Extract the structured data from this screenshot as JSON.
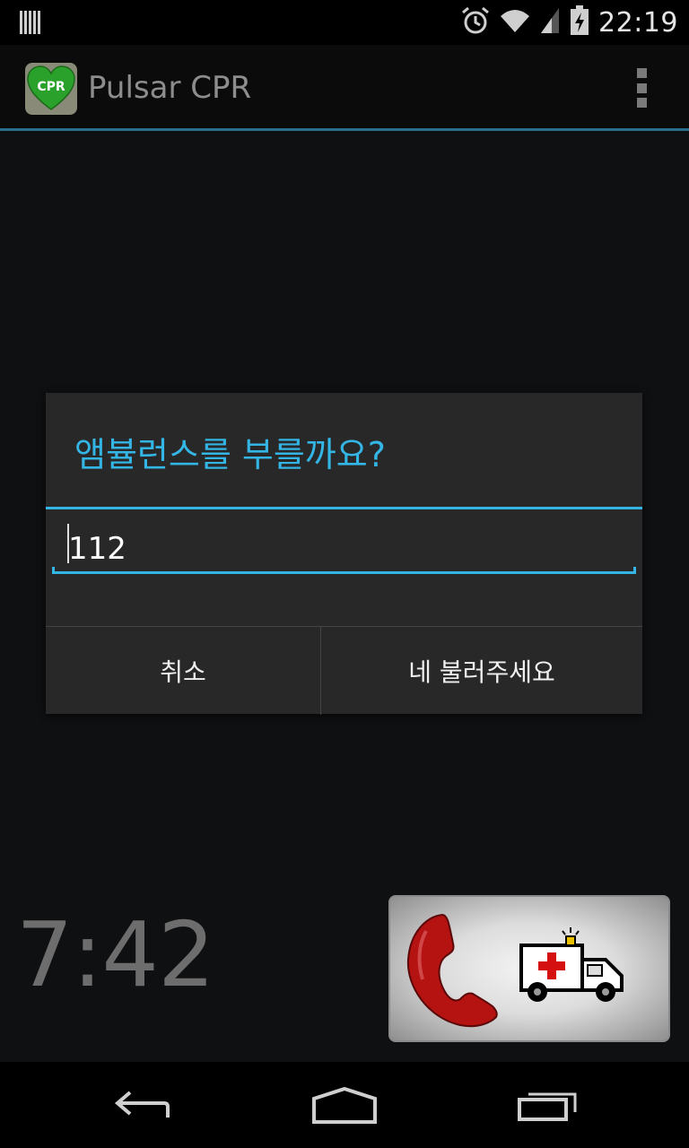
{
  "status_bar": {
    "time": "22:19",
    "icons": [
      "notification-bars-icon",
      "alarm-icon",
      "wifi-icon",
      "signal-icon",
      "battery-charging-icon"
    ]
  },
  "action_bar": {
    "app_icon_label": "CPR",
    "title": "Pulsar CPR",
    "overflow_icon": "overflow-menu-icon"
  },
  "dialog": {
    "title": "앰뷸런스를 부를까요?",
    "input_value": "112",
    "cancel_label": "취소",
    "confirm_label": "네 불러주세요"
  },
  "main": {
    "timer": "7:42",
    "call_button_icons": [
      "phone-handset-icon",
      "ambulance-icon"
    ]
  },
  "nav_bar": {
    "icons": [
      "back-icon",
      "home-icon",
      "recent-apps-icon"
    ]
  },
  "colors": {
    "accent": "#33b5e5",
    "dialog_bg": "#282828",
    "content_bg": "#0f1012"
  }
}
